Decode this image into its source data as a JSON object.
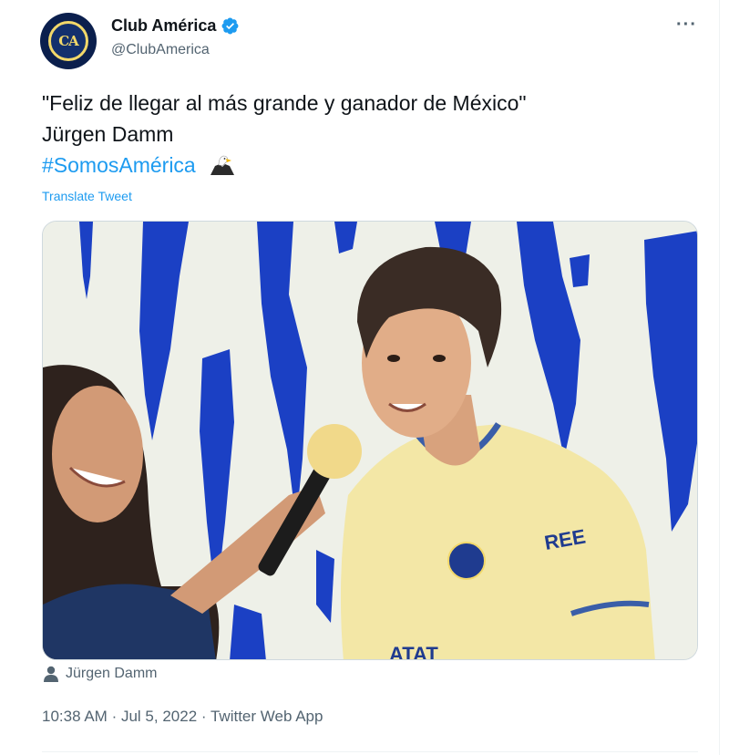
{
  "author": {
    "name": "Club América",
    "handle": "@ClubAmerica",
    "verified": true,
    "avatar_initials": "CA"
  },
  "tweet": {
    "line1": "\"Feliz de llegar al más grande y ganador de México\"",
    "line2": "Jürgen Damm",
    "hashtag": "#SomosAmérica",
    "emoji": "eagle-icon",
    "translate_label": "Translate Tweet"
  },
  "media": {
    "tagged_person": "Jürgen Damm"
  },
  "footer": {
    "time": "10:38 AM",
    "date": "Jul 5, 2022",
    "source": "Twitter Web App",
    "separator": "·"
  },
  "colors": {
    "link": "#1d9bf0",
    "secondary_text": "#536471",
    "jersey": "#f3e7a6",
    "background_blue": "#1a3ebd"
  }
}
